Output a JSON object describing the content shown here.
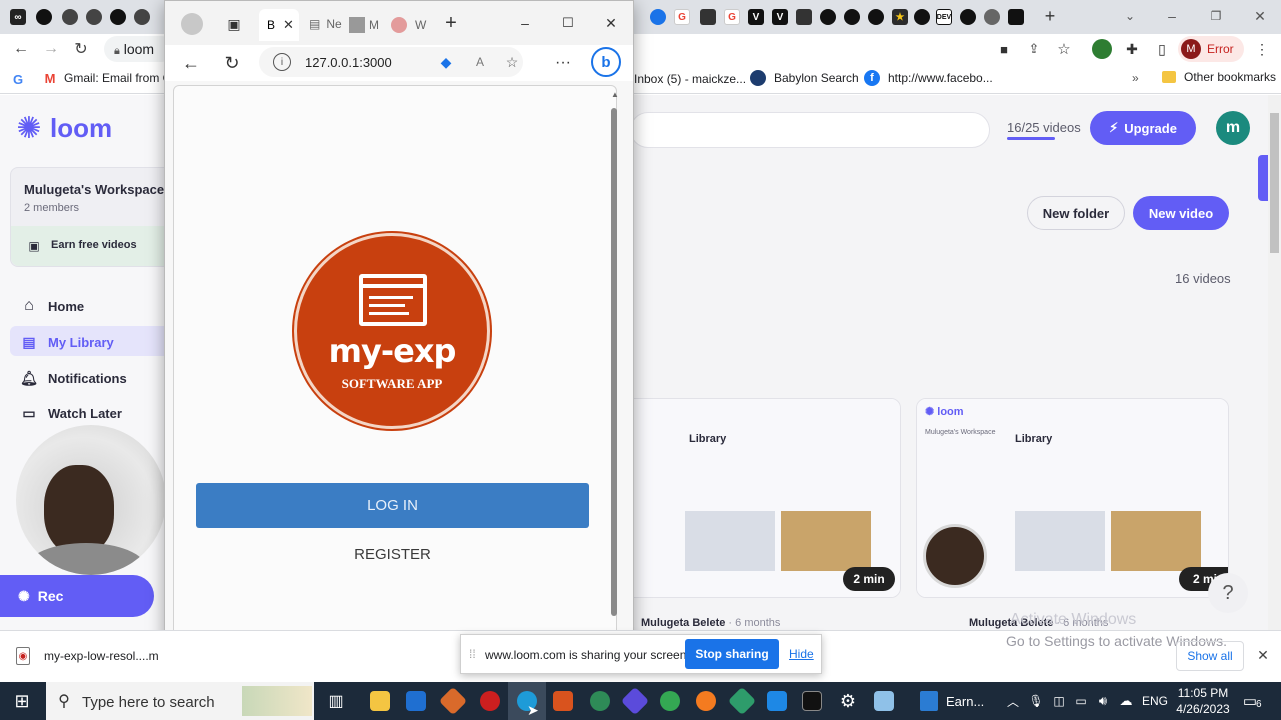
{
  "chrome": {
    "address": "loom",
    "profile_status": "Error",
    "profile_initial": "M",
    "bookmarks": {
      "gmail": "Gmail: Email from G",
      "inbox": "Inbox (5) - maickze...",
      "babylon": "Babylon Search",
      "facebook": "http://www.facebo...",
      "other": "Other bookmarks"
    }
  },
  "loom": {
    "logo": "loom",
    "workspace_name": "Mulugeta's Workspace",
    "workspace_members": "2 members",
    "earn": "Earn free videos",
    "nav": [
      "Home",
      "My Library",
      "Notifications",
      "Watch Later"
    ],
    "record_label": "Rec",
    "video_count": "16/25 videos",
    "upgrade": "Upgrade",
    "avatar_initial": "m",
    "new_folder": "New folder",
    "new_video": "New video",
    "videos_total": "16 videos",
    "card1_author": "Mulugeta Belete",
    "card1_age": "6 months",
    "card2_author": "Mulugeta Belete",
    "card2_age": "6 months",
    "duration1": "2 min",
    "duration2": "2 mi",
    "thumb_title": "Library",
    "thumb_workspace": "Mulugeta's Workspace",
    "activate_title": "Activate Windows",
    "activate_sub": "Go to Settings to activate Windows.",
    "help": "?"
  },
  "edge": {
    "tab_active": "B",
    "tab_labels": [
      "Ne",
      "M",
      "W"
    ],
    "address": "127.0.0.1:3000",
    "page": {
      "logo_title": "my-exp",
      "logo_sub": "SOFTWARE APP",
      "login": "LOG IN",
      "register": "REGISTER"
    }
  },
  "sharebar": {
    "message": "www.loom.com is sharing your screen.",
    "stop": "Stop sharing",
    "hide": "Hide"
  },
  "downloads": {
    "file": "my-exp-low-resol....m",
    "show_all": "Show all"
  },
  "taskbar": {
    "search_placeholder": "Type here to search",
    "earn_label": "Earn...",
    "language": "ENG",
    "time": "11:05 PM",
    "date": "4/26/2023",
    "notifications": "6"
  },
  "colors": {
    "loom_purple": "#625df5",
    "logo_red": "#c8400f",
    "login_blue": "#3b7dc4",
    "share_blue": "#1a73e8"
  }
}
